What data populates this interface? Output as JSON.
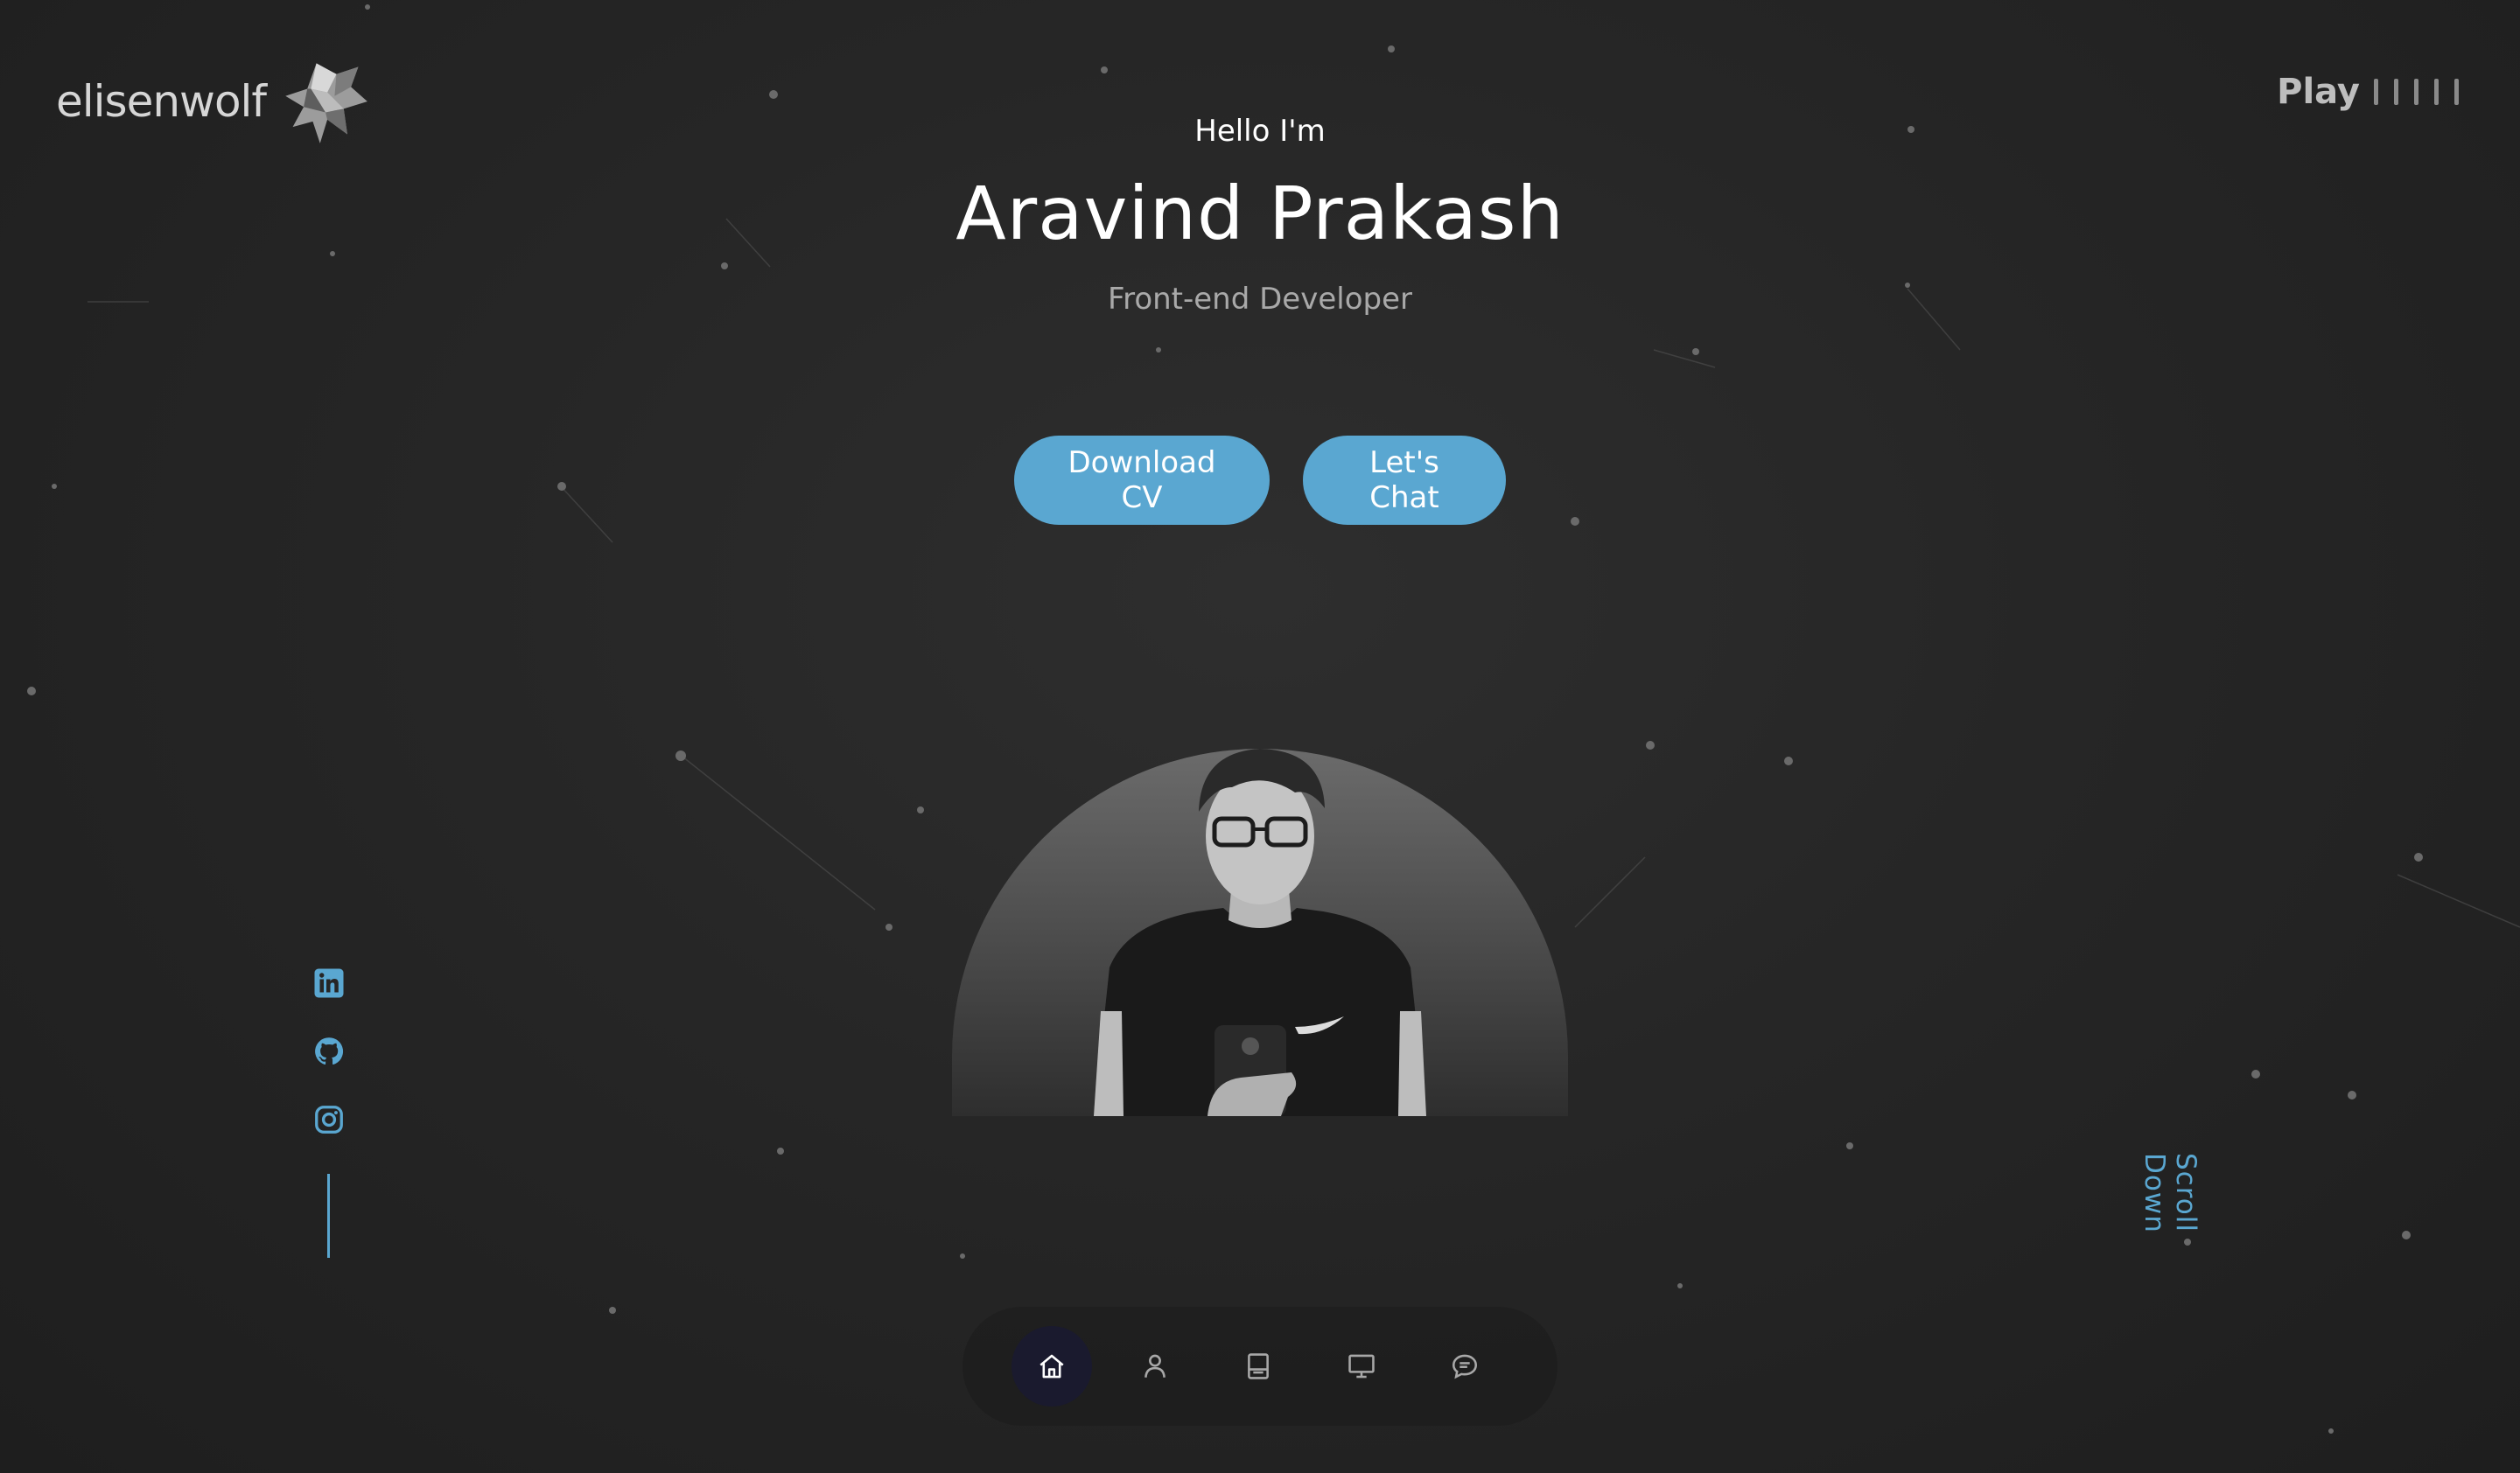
{
  "brand": {
    "name": "elisenwolf",
    "logo_icon": "wolf-head-icon"
  },
  "audio": {
    "label": "Play",
    "bar_count": 5
  },
  "hero": {
    "greeting": "Hello I'm",
    "name": "Aravind Prakash",
    "role": "Front-end Developer",
    "buttons": {
      "download_cv": "Download CV",
      "lets_chat": "Let's Chat"
    }
  },
  "socials": [
    {
      "icon": "linkedin-icon"
    },
    {
      "icon": "github-icon"
    },
    {
      "icon": "instagram-icon"
    }
  ],
  "scroll_hint": "Scroll Down",
  "nav": [
    {
      "icon": "home-icon",
      "active": true
    },
    {
      "icon": "user-icon",
      "active": false
    },
    {
      "icon": "book-icon",
      "active": false
    },
    {
      "icon": "monitor-icon",
      "active": false
    },
    {
      "icon": "chat-icon",
      "active": false
    }
  ],
  "colors": {
    "accent": "#5aa7d1",
    "background": "#262626",
    "text": "#ffffff",
    "muted_text": "#a9a9a9",
    "nav_active": "#1a1a2e"
  }
}
